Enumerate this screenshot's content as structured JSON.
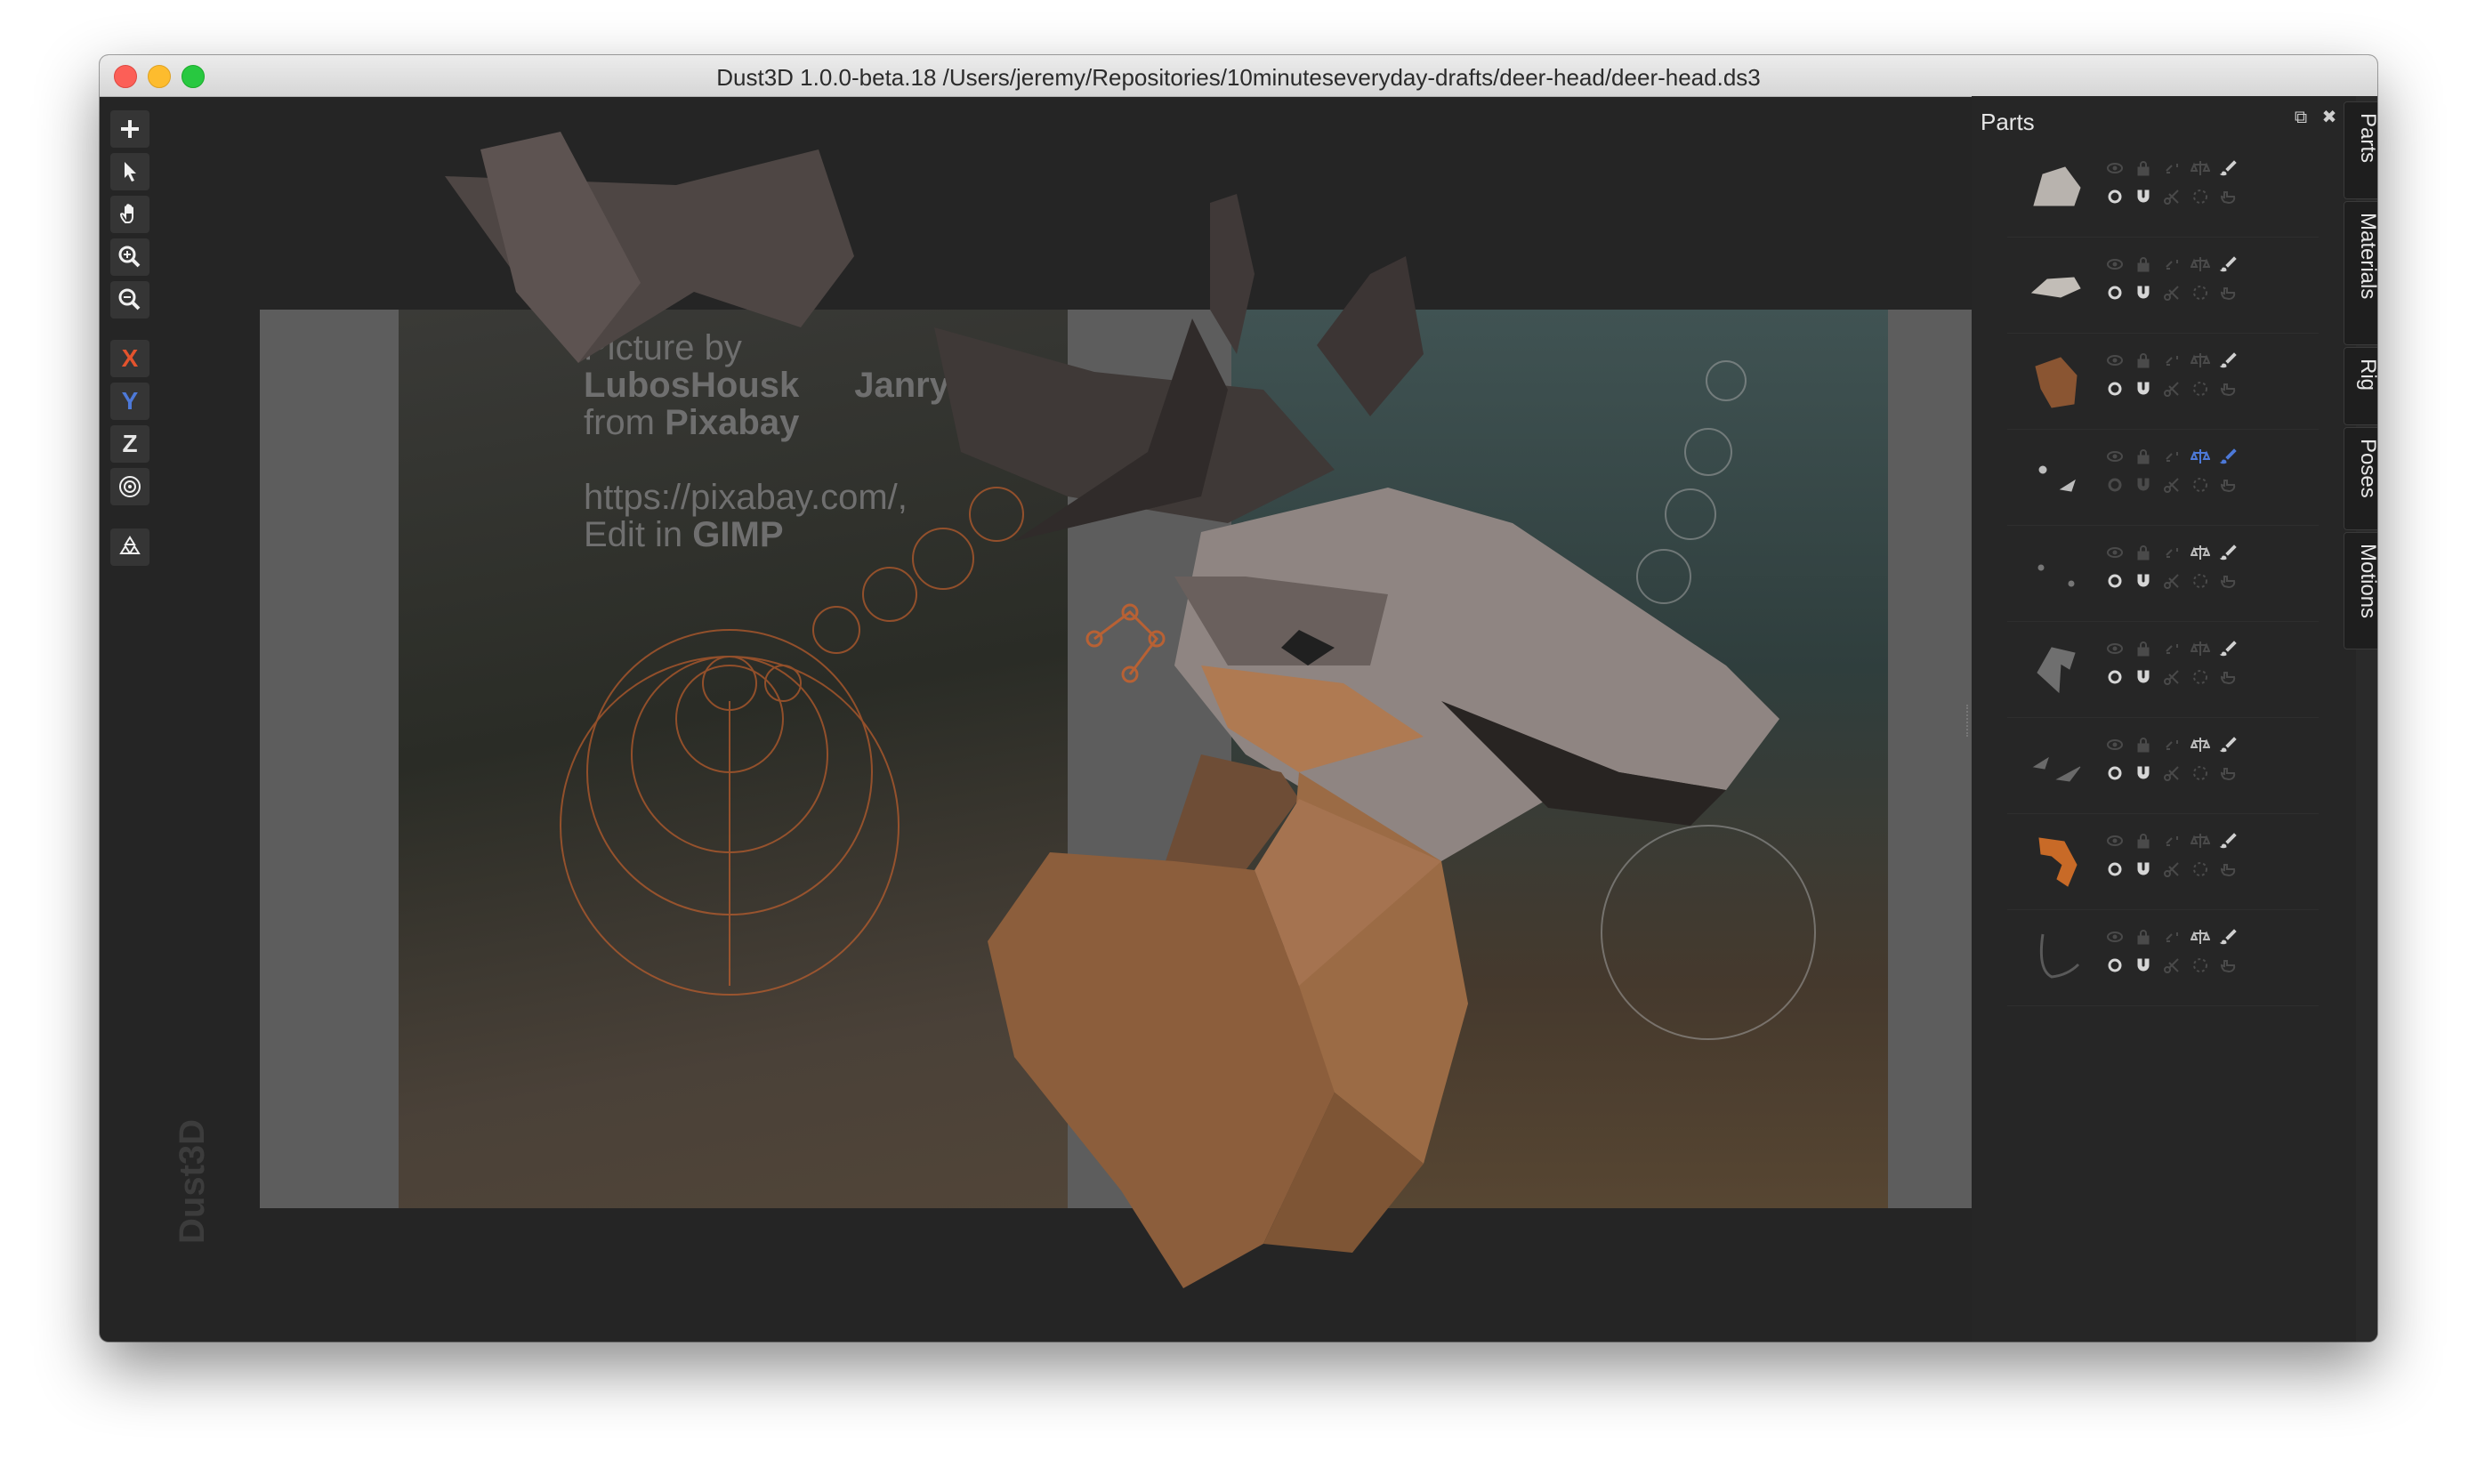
{
  "window": {
    "title": "Dust3D 1.0.0-beta.18 /Users/jeremy/Repositories/10minuteseveryday-drafts/deer-head/deer-head.ds3"
  },
  "toolbar": {
    "tools": [
      {
        "name": "add-icon"
      },
      {
        "name": "select-pointer-icon"
      },
      {
        "name": "hand-icon"
      },
      {
        "name": "zoom-in-icon"
      },
      {
        "name": "zoom-out-icon"
      },
      {
        "name": "x-axis-toggle",
        "label": "X",
        "color": "#e3532d"
      },
      {
        "name": "y-axis-toggle",
        "label": "Y",
        "color": "#4d79d8"
      },
      {
        "name": "z-axis-toggle",
        "label": "Z",
        "color": "#e6e6e6"
      },
      {
        "name": "radial-icon"
      },
      {
        "name": "recycle-icon"
      }
    ]
  },
  "reference": {
    "line1": "Picture by",
    "line2a": "LubosHousk",
    "line2b": "Janrye",
    "line3a": "from ",
    "line3b": "Pixabay",
    "line4": "https://pixabay.com/,",
    "line5a": "Edit in ",
    "line5b": "GIMP"
  },
  "watermark": "Dust3D",
  "dock": {
    "title": "Parts",
    "float_icon": "float-icon",
    "close_icon": "close-icon"
  },
  "parts": [
    {
      "preview_color": "#b8b3ae",
      "shape": "cap",
      "active": false
    },
    {
      "preview_color": "#c2bdb7",
      "shape": "flat",
      "active": false
    },
    {
      "preview_color": "#8a5532",
      "shape": "block",
      "active": false
    },
    {
      "preview_color": "#bdbdbd",
      "shape": "dots",
      "active": true
    },
    {
      "preview_color": "#777777",
      "shape": "dot",
      "active": false
    },
    {
      "preview_color": "#6f6f6f",
      "shape": "curl",
      "active": false
    },
    {
      "preview_color": "#6a6a6a",
      "shape": "fin",
      "active": false
    },
    {
      "preview_color": "#c86a27",
      "shape": "hook",
      "active": false
    },
    {
      "preview_color": "#5a5a5a",
      "shape": "curve",
      "active": false
    }
  ],
  "side_tabs": [
    "Parts",
    "Materials",
    "Rig",
    "Poses",
    "Motions"
  ],
  "colors": {
    "accent_orange": "#c9622d",
    "accent_blue": "#4d79d8",
    "background": "#252525"
  }
}
